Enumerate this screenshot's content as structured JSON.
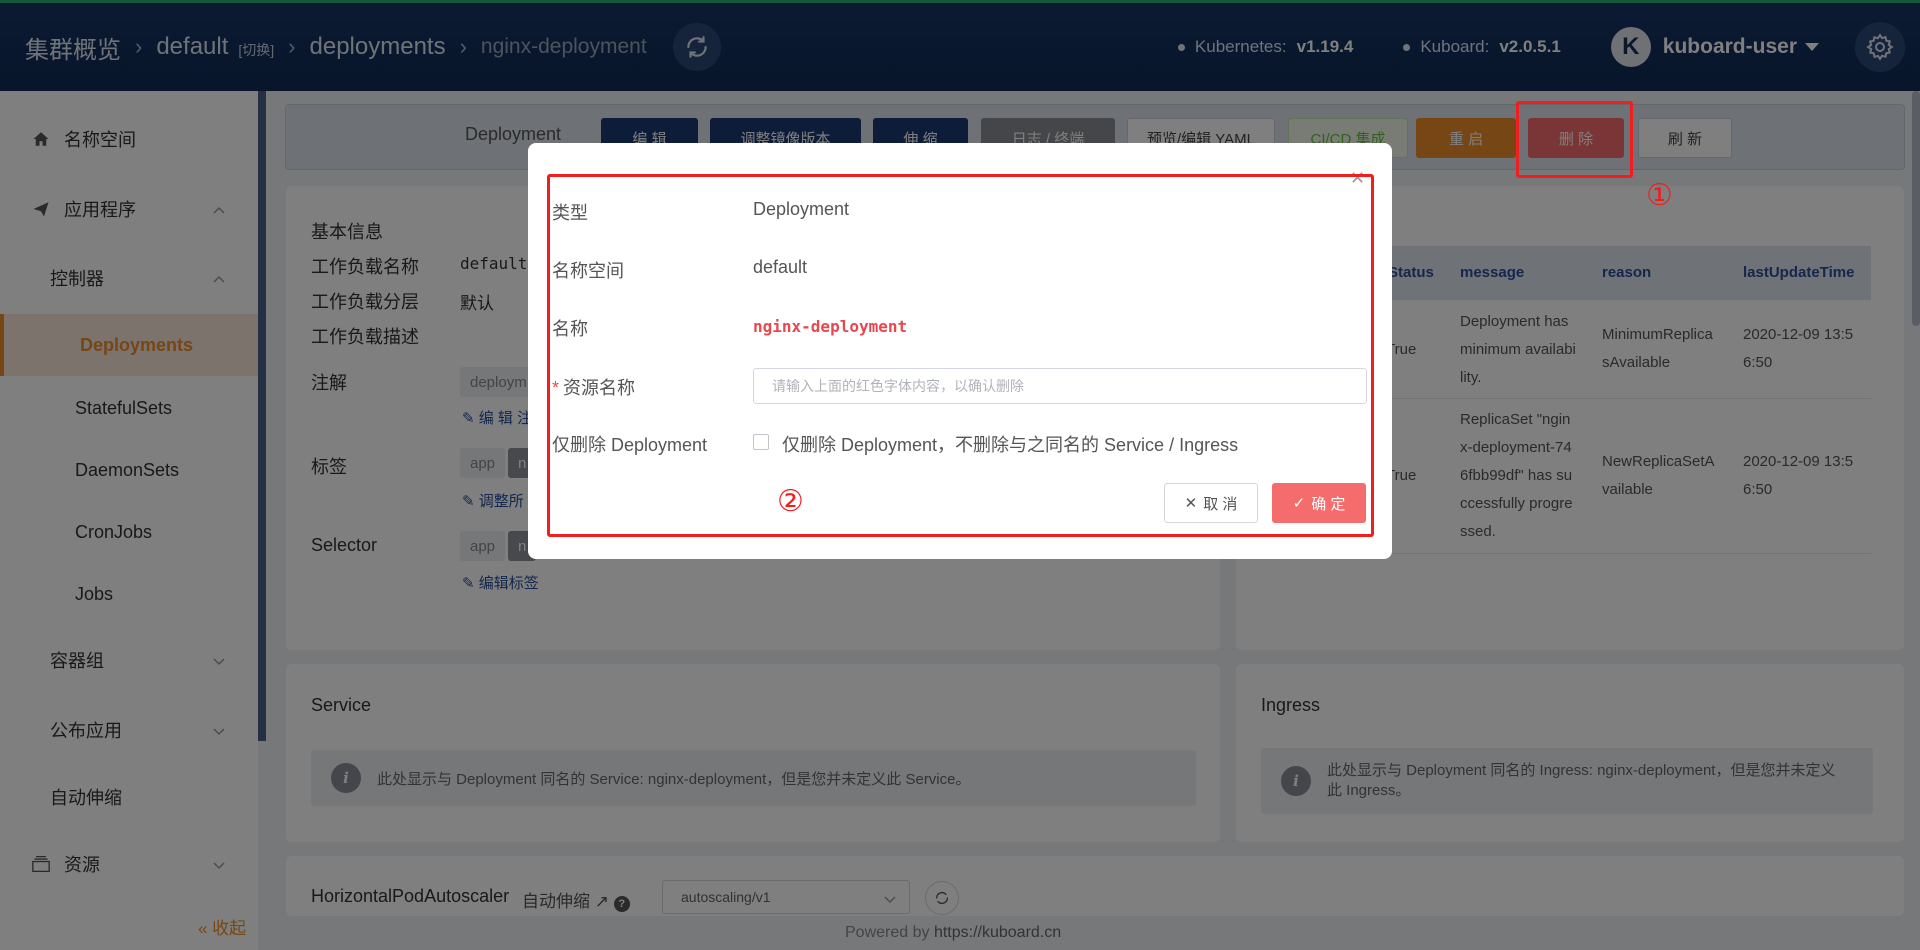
{
  "header": {
    "breadcrumb": {
      "root": "集群概览",
      "namespace": "default",
      "switch": "[切换]",
      "kind": "deployments",
      "name": "nginx-deployment"
    },
    "kubernetes_label": "Kubernetes:",
    "kubernetes_version": "v1.19.4",
    "kuboard_label": "Kuboard:",
    "kuboard_version": "v2.0.5.1",
    "avatar_letter": "K",
    "username": "kuboard-user"
  },
  "sidebar": {
    "items": [
      {
        "label": "名称空间"
      },
      {
        "label": "应用程序"
      },
      {
        "label": "控制器"
      },
      {
        "label": "Deployments"
      },
      {
        "label": "StatefulSets"
      },
      {
        "label": "DaemonSets"
      },
      {
        "label": "CronJobs"
      },
      {
        "label": "Jobs"
      },
      {
        "label": "容器组"
      },
      {
        "label": "公布应用"
      },
      {
        "label": "自动伸缩"
      },
      {
        "label": "资源"
      }
    ],
    "collapse": "« 收起"
  },
  "toolbar": {
    "kind_label": "Deployment",
    "edit": "编 辑",
    "adjust_image": "调整镜像版本",
    "scale": "伸 缩",
    "logs": "日志 / 终端",
    "yaml": "预览/编辑 YAML",
    "cicd": "CI/CD 集成",
    "restart": "重 启",
    "delete": "删 除",
    "refresh": "刷 新"
  },
  "basic_info": {
    "title": "基本信息",
    "workload_name_label": "工作负载名称",
    "workload_name_value": "default",
    "workload_layer_label": "工作负载分层",
    "workload_layer_value": "默认",
    "workload_desc_label": "工作负载描述",
    "annotation_label": "注解",
    "annotation_tag": "deploym",
    "annotation_edit": "编 辑 注",
    "labels_label": "标签",
    "labels_tag_key": "app",
    "labels_tag_val": "n",
    "labels_edit": "调整所",
    "selector_label": "Selector",
    "selector_tag_key": "app",
    "selector_tag_val": "n",
    "selector_edit": "编辑标签"
  },
  "conditions": {
    "columns": [
      "Status",
      "message",
      "reason",
      "lastUpdateTime"
    ],
    "rows": [
      {
        "status": "True",
        "message": [
          "Deployment has",
          "minimum availabi",
          "lity."
        ],
        "reason": [
          "MinimumReplica",
          "sAvailable"
        ],
        "time": [
          "2020-12-09 13:5",
          "6:50"
        ]
      },
      {
        "status": "True",
        "message": [
          "ReplicaSet \"ngin",
          "x-deployment-74",
          "6fbb99df\" has su",
          "ccessfully progre",
          "ssed."
        ],
        "reason": [
          "NewReplicaSetA",
          "vailable"
        ],
        "time": [
          "2020-12-09 13:5",
          "6:50"
        ]
      }
    ]
  },
  "service": {
    "title": "Service",
    "info": "此处显示与 Deployment 同名的 Service: nginx-deployment，但是您并未定义此 Service。"
  },
  "ingress": {
    "title": "Ingress",
    "info_line1": "此处显示与 Deployment 同名的 Ingress: nginx-deployment，但是您并未定义",
    "info_line2": "此 Ingress。"
  },
  "hpa": {
    "title": "HorizontalPodAutoscaler",
    "sub": "自动伸缩",
    "select_value": "autoscaling/v1"
  },
  "footer": {
    "prefix": "Powered by",
    "link": "https://kuboard.cn"
  },
  "dialog": {
    "type_label": "类型",
    "type_value": "Deployment",
    "ns_label": "名称空间",
    "ns_value": "default",
    "name_label": "名称",
    "name_value": "nginx-deployment",
    "required_mark": "*",
    "resource_label": "资源名称",
    "resource_placeholder": "请输入上面的红色字体内容，以确认删除",
    "only_label": "仅删除 Deployment",
    "only_checkbox_text": "仅删除 Deployment，不删除与之同名的 Service / Ingress",
    "cancel": "取 消",
    "confirm": "确 定"
  },
  "annotations": {
    "one": "①",
    "two": "②"
  },
  "colors": {
    "header_bg": "#173566",
    "accent_orange": "#ef8d2b",
    "danger": "#f56c6c",
    "annotation_red": "#f01e1e",
    "primary_btn": "#1a3a72"
  }
}
